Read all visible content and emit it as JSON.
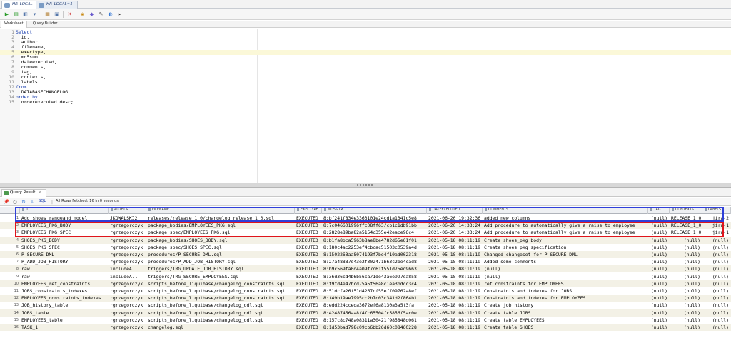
{
  "connection_tabs": [
    "HR_LOCAL",
    "HR_LOCAL~1"
  ],
  "editor_tabs": [
    "Worksheet",
    "Query Builder"
  ],
  "editor_lines": [
    {
      "n": "1",
      "text": "Select",
      "kw": true
    },
    {
      "n": "2",
      "text": "  id,",
      "kw": false
    },
    {
      "n": "3",
      "text": "  author,",
      "kw": false
    },
    {
      "n": "4",
      "text": "  filename,",
      "kw": false
    },
    {
      "n": "5",
      "text": "  exectype,",
      "kw": false
    },
    {
      "n": "6",
      "text": "  md5sum,",
      "kw": false
    },
    {
      "n": "7",
      "text": "  dateexecuted,",
      "kw": false
    },
    {
      "n": "8",
      "text": "  comments,",
      "kw": false
    },
    {
      "n": "9",
      "text": "  tag,",
      "kw": false
    },
    {
      "n": "10",
      "text": "  contexts,",
      "kw": false
    },
    {
      "n": "11",
      "text": "  labels",
      "kw": false
    },
    {
      "n": "12",
      "text": "from",
      "kw": true
    },
    {
      "n": "13",
      "text": "  DATABASECHANGELOG",
      "kw": false
    },
    {
      "n": "14",
      "text": "order by",
      "kw": true
    },
    {
      "n": "15",
      "text": "  orderexecuted desc;",
      "kw": false
    }
  ],
  "highlighted_line": "5",
  "result_tab": {
    "label": "Query Result",
    "close": "×"
  },
  "result_toolbar": {
    "sql_label": "SQL",
    "status": "All Rows Fetched: 16 in 0 seconds"
  },
  "columns": [
    "ID",
    "AUTHOR",
    "FILENAME",
    "EXECTYPE",
    "MD5SUM",
    "DATEEXECUTED",
    "COMMENTS",
    "TAG",
    "CONTEXTS",
    "LABELS"
  ],
  "rows": [
    [
      "1",
      "Add_shoes_rangeand_model",
      "JKOWALSKI2",
      "releases/release_1_0/changelog_release_1_0.sql",
      "EXECUTED",
      "8:bf241f834e3363101e24cd1a1341c5e8",
      "2021-06-20 19:32:36",
      "added new columns",
      "(null)",
      "RELEASE_1_0",
      "jira-2"
    ],
    [
      "2",
      "EMPLOYEES_PKG_BODY",
      "rgrzegorczyk",
      "package_bodies/EMPLOYEES_PKG.sql",
      "EXECUTED",
      "8:7c046601996ffc08ff63/cb1c1db91bb",
      "2021-06-20 14:33:24",
      "Add procedure to automatically give a raise to employee",
      "(null)",
      "RELEASE_1_0",
      "jira-1"
    ],
    [
      "3",
      "EMPLOYEES_PKG_SPEC",
      "rgrzegorczyk",
      "package_spec/EMPLOYEES_PKG.sql",
      "EXECUTED",
      "8:2828e89ba82a5154c355e42eace96c4",
      "2021-06-20 14:33:24",
      "Add procedure to automatically give a raise to employee",
      "(null)",
      "RELEASE_1_0",
      "jira-1"
    ],
    [
      "4",
      "SHOES_PKG_BODY",
      "rgrzegorczyk",
      "package_bodies/SHOES_BODY.sql",
      "EXECUTED",
      "8:b1fa8bca5963b8ae8be4782d65e61f01",
      "2021-05-18 08:11:19",
      "Create shoes_pkg body",
      "(null)",
      "(null)",
      "(null)"
    ],
    [
      "5",
      "SHOES_PKG_SPEC",
      "rgrzegorczyk",
      "package_spec/SHOES_SPEC.sql",
      "EXECUTED",
      "8:180c4ac2253ef4cbcac51503c0539a4d",
      "2021-05-18 08:11:19",
      "Create shoes_pkg specification",
      "(null)",
      "(null)",
      "(null)"
    ],
    [
      "6",
      "P_SECURE_DML",
      "rgrzegorczyk",
      "procedures/P_SECURE_DML.sql",
      "EXECUTED",
      "8:1502263aa8074193f7be4f10ad002318",
      "2021-05-18 08:11:19",
      "Changed changeset for P_SECURE_DML",
      "(null)",
      "(null)",
      "(null)"
    ],
    [
      "7",
      "P_ADD_JOB_HISTORY",
      "rgrzegorczyk",
      "procedures/P_ADD_JOB_HISTORY.sql",
      "EXECUTED",
      "8:27a48887d43e2f302471b63c2be4cad8",
      "2021-05-18 08:11:19",
      "Added some comments",
      "(null)",
      "(null)",
      "(null)"
    ],
    [
      "8",
      "raw",
      "includeAll",
      "triggers/TRG_UPDATE_JOB_HISTORY.sql",
      "EXECUTED",
      "8:b9c569fa0d4a09f7c61f551d75ed9663",
      "2021-05-18 08:11:19",
      "(null)",
      "(null)",
      "(null)",
      "(null)"
    ],
    [
      "9",
      "raw",
      "includeAll",
      "triggers/TRG_SECURE_EMPLOYEES.sql",
      "EXECUTED",
      "8:36d36cd4b6b56ca71de43a6e997da858",
      "2021-05-18 08:11:19",
      "(null)",
      "(null)",
      "(null)",
      "(null)"
    ],
    [
      "10",
      "EMPLOYEES_ref_constraints",
      "rgrzegorczyk",
      "scripts_before_liquibase/changelog_constraints.sql",
      "EXECUTED",
      "8:f9fd4e47bcd75a5f56a8c1ea3bdcc3c4",
      "2021-05-18 08:11:19",
      "ref constraints  for EMPLOYEES",
      "(null)",
      "(null)",
      "(null)"
    ],
    [
      "11",
      "JOBS_constraints_indexes",
      "rgrzegorczyk",
      "scripts_before_liquibase/changelog_constraints.sql",
      "EXECUTED",
      "8:51dcfa26f51d4267cf55eff09762a8ef",
      "2021-05-18 08:11:19",
      "Constraints and indexes for JOBS",
      "(null)",
      "(null)",
      "(null)"
    ],
    [
      "12",
      "EMPLOYEES_constraints_indexes",
      "rgrzegorczyk",
      "scripts_before_liquibase/changelog_constraints.sql",
      "EXECUTED",
      "8:f49b19ae7995cc2b7c03c341d2f864b1",
      "2021-05-18 08:11:19",
      "Constraints and indexes  for EMPLOYEES",
      "(null)",
      "(null)",
      "(null)"
    ],
    [
      "13",
      "JOB_history_table",
      "rgrzegorczyk",
      "scripts_before_liquibase/changelog_ddl.sql",
      "EXECUTED",
      "8:edd224cceda3672ef6a8130a3a5f3fa",
      "2021-05-18 08:11:19",
      "Create job history",
      "(null)",
      "(null)",
      "(null)"
    ],
    [
      "14",
      "JOBS_table",
      "rgrzegorczyk",
      "scripts_before_liquibase/changelog_ddl.sql",
      "EXECUTED",
      "8:42487456aa8f4fc65504fc5856f5ac0e",
      "2021-05-18 08:11:19",
      "Create table JOBS",
      "(null)",
      "(null)",
      "(null)"
    ],
    [
      "15",
      "EMPLOYEES_table",
      "rgrzegorczyk",
      "scripts_before_liquibase/changelog_ddl.sql",
      "EXECUTED",
      "8:157c8c748a08311a30421f985848d061",
      "2021-05-18 08:11:19",
      "Create table EMPLOYEES",
      "(null)",
      "(null)",
      "(null)"
    ],
    [
      "16",
      "TASK_1",
      "rgrzegorczyk",
      "changelog.sql",
      "EXECUTED",
      "8:1d53bad798c09cb6bb26d60c08460228",
      "2021-05-18 08:11:19",
      "Create table SHOES",
      "(null)",
      "(null)",
      "(null)"
    ]
  ],
  "annotation_colors": {
    "blue": "#2f3fd9",
    "red": "#e0141c"
  }
}
